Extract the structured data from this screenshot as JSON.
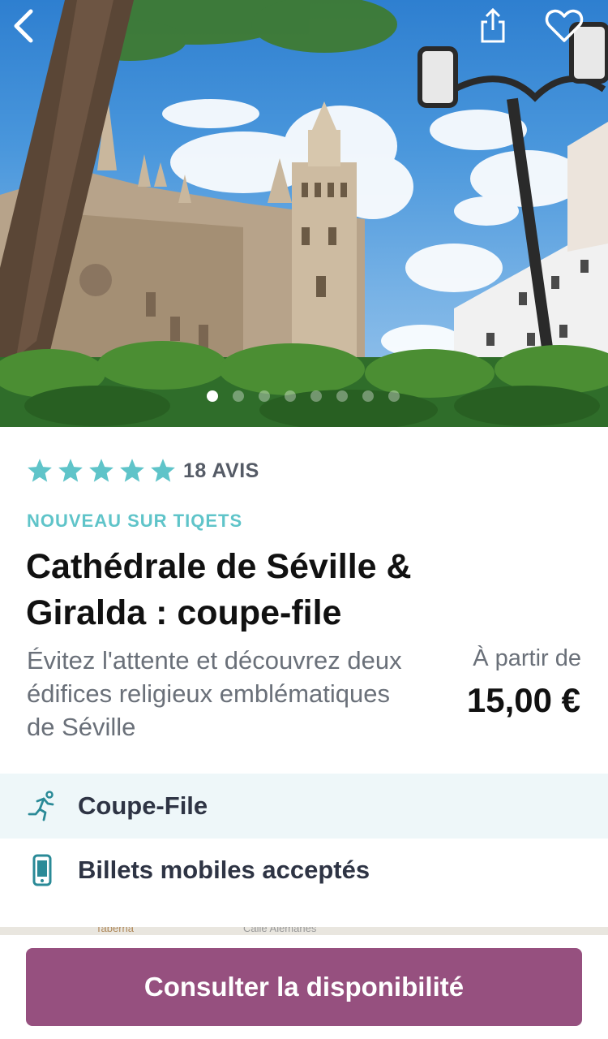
{
  "hero": {
    "image_name": "seville-cathedral-giralda-photo",
    "slide_count": 8,
    "active_slide": 1
  },
  "rating": {
    "stars": 5,
    "reviews_label": "18 AVIS",
    "star_color": "#5fc4c9"
  },
  "product": {
    "tag": "NOUVEAU SUR TIQETS",
    "title": "Cathédrale de Séville & Giralda : coupe-file",
    "description": "Évitez l'attente et découvrez deux édifices religieux emblématiques de Séville",
    "price_label": "À partir de",
    "price": "15,00 €"
  },
  "features": [
    {
      "icon": "runner-icon",
      "label": "Coupe-File"
    },
    {
      "icon": "mobile-phone-icon",
      "label": "Billets mobiles acceptés"
    }
  ],
  "map": {
    "street_1": "Taberna",
    "street_2": "Calle Alemanes"
  },
  "cta": {
    "label": "Consulter la disponibilité",
    "color": "#96507f"
  }
}
